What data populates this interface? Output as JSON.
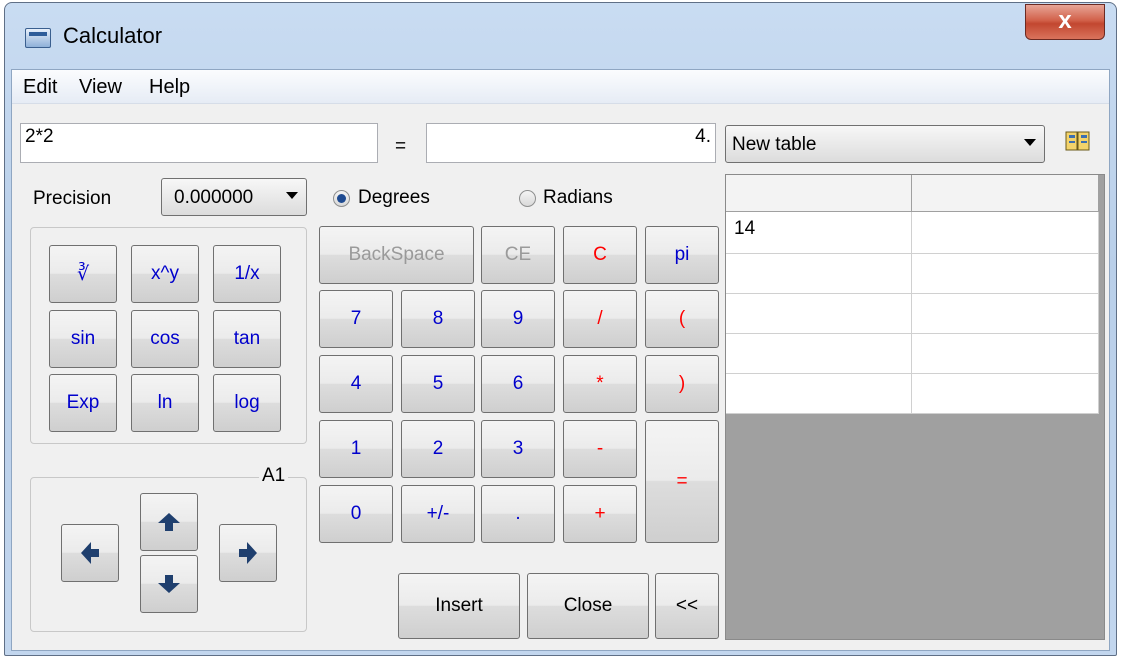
{
  "window": {
    "title": "Calculator",
    "close_label": "x"
  },
  "menu": [
    "Edit",
    "View",
    "Help"
  ],
  "expression": {
    "value": "2*2",
    "equals_label": "=",
    "result": "4."
  },
  "table_select": {
    "value": "New table"
  },
  "precision": {
    "label": "Precision",
    "value": "0.000000"
  },
  "angle": {
    "degrees_label": "Degrees",
    "radians_label": "Radians",
    "selected": "Degrees"
  },
  "functions": [
    "∛",
    "x^y",
    "1/x",
    "sin",
    "cos",
    "tan",
    "Exp",
    "ln",
    "log"
  ],
  "cell_nav": {
    "label": "A1"
  },
  "keys": {
    "backspace": "BackSpace",
    "ce": "CE",
    "c": "C",
    "pi": "pi",
    "n7": "7",
    "n8": "8",
    "n9": "9",
    "div": "/",
    "lparen": "(",
    "n4": "4",
    "n5": "5",
    "n6": "6",
    "mul": "*",
    "rparen": ")",
    "n1": "1",
    "n2": "2",
    "n3": "3",
    "minus": "-",
    "n0": "0",
    "sign": "+/-",
    "dot": ".",
    "plus": "+",
    "eq": "="
  },
  "actions": {
    "insert": "Insert",
    "close": "Close",
    "collapse": "<<"
  },
  "table": {
    "rows": [
      [
        "14",
        ""
      ],
      [
        "",
        ""
      ],
      [
        "",
        ""
      ],
      [
        "",
        ""
      ],
      [
        "",
        ""
      ]
    ]
  },
  "colors": {
    "key_text": "#0000cc",
    "operator_text": "#ff0000",
    "disabled_text": "#9a9a9a"
  }
}
